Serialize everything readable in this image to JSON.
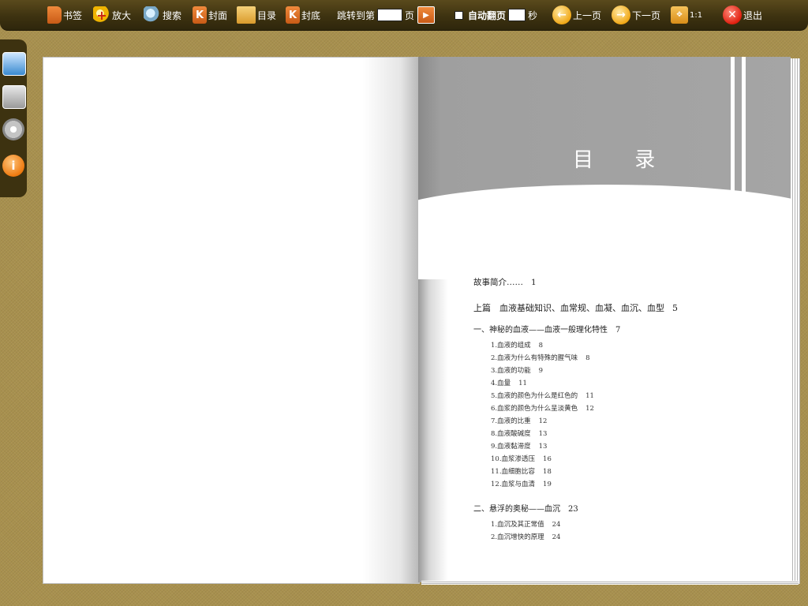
{
  "toolbar": {
    "bookmark": "书签",
    "zoom": "放大",
    "search": "搜索",
    "cover": "封面",
    "toc": "目录",
    "back_cover": "封底",
    "jump_label": "跳转到第",
    "page_unit": "页",
    "auto_flip": "自动翻页",
    "seconds": "秒",
    "prev": "上一页",
    "next": "下一页",
    "ratio": "1:1",
    "exit": "退出"
  },
  "page": {
    "toc_title": "目 录",
    "entries": [
      {
        "text": "故事简介……",
        "page": "1",
        "level": "intro"
      },
      {
        "text": "上篇　血液基础知识、血常规、血凝、血沉、血型",
        "page": "5",
        "level": "part"
      },
      {
        "text": "一、神秘的血液——血液一般理化特性",
        "page": "7",
        "level": "chapter"
      },
      {
        "text": "1.血液的组成",
        "page": "8",
        "level": "item"
      },
      {
        "text": "2.血液为什么有特殊的腥气味",
        "page": "8",
        "level": "item"
      },
      {
        "text": "3.血液的功能",
        "page": "9",
        "level": "item"
      },
      {
        "text": "4.血量",
        "page": "11",
        "level": "item"
      },
      {
        "text": "5.血液的颜色为什么是红色的",
        "page": "11",
        "level": "item"
      },
      {
        "text": "6.血浆的颜色为什么呈淡黄色",
        "page": "12",
        "level": "item"
      },
      {
        "text": "7.血液的比重",
        "page": "12",
        "level": "item"
      },
      {
        "text": "8.血液酸碱度",
        "page": "13",
        "level": "item"
      },
      {
        "text": "9.血液黏滞度",
        "page": "13",
        "level": "item"
      },
      {
        "text": "10.血浆渗透压",
        "page": "16",
        "level": "item"
      },
      {
        "text": "11.血细胞比容",
        "page": "18",
        "level": "item"
      },
      {
        "text": "12.血浆与血清",
        "page": "19",
        "level": "item"
      },
      {
        "text": "二、悬浮的奥秘——血沉",
        "page": "23",
        "level": "chapter"
      },
      {
        "text": "1.血沉及其正常值",
        "page": "24",
        "level": "item"
      },
      {
        "text": "2.血沉增快的原理",
        "page": "24",
        "level": "item"
      }
    ]
  },
  "colors": {
    "toolbar": "#3d3210",
    "background": "#a8904e",
    "header_band": "#a5a5a5"
  },
  "icons": [
    "bookmark-icon",
    "zoom-icon",
    "search-icon",
    "cover-icon",
    "toc-icon",
    "back-cover-icon",
    "play-icon",
    "prev-arrow-icon",
    "next-arrow-icon",
    "fit-icon",
    "exit-icon",
    "image-icon",
    "print-icon",
    "gear-icon",
    "info-icon"
  ]
}
